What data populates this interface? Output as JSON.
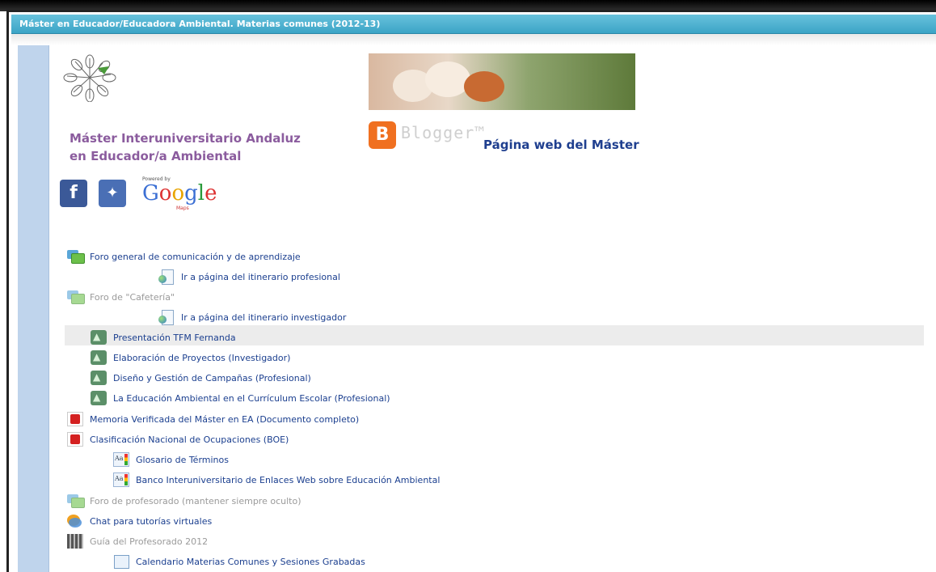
{
  "window": {
    "title": "Máster en Educador/Educadora Ambiental. Materias comunes (2012-13)"
  },
  "header": {
    "program_line1": "Máster Interuniversitario Andaluz",
    "program_line2": "en Educador/a  Ambiental",
    "blogger_label": "Blogger™",
    "web_link": "Página web del Máster",
    "social": {
      "facebook": "f",
      "twitter": "t",
      "google": "Google",
      "powered_by": "Powered by",
      "maps": "Maps"
    }
  },
  "resources": [
    {
      "label": "Foro general de comunicación y de aprendizaje",
      "icon": "forum-icon",
      "hidden": false
    },
    {
      "label": "Ir a página del itinerario profesional",
      "icon": "page-icon",
      "hidden": false
    },
    {
      "label": "Foro de \"Cafetería\"",
      "icon": "forum-icon",
      "hidden": true
    },
    {
      "label": "Ir a página del itinerario investigador",
      "icon": "page-icon",
      "hidden": false
    },
    {
      "label": "Presentación TFM Fernanda",
      "icon": "people-icon",
      "hidden": false
    },
    {
      "label": "Elaboración de Proyectos (Investigador)",
      "icon": "people-icon",
      "hidden": false
    },
    {
      "label": "Diseño y Gestión de Campañas (Profesional)",
      "icon": "people-icon",
      "hidden": false
    },
    {
      "label": "La Educación Ambiental en el Currículum Escolar (Profesional)",
      "icon": "people-icon",
      "hidden": false
    },
    {
      "label": "Memoria Verificada del Máster en EA (Documento completo)",
      "icon": "pdf-icon",
      "hidden": false
    },
    {
      "label": "Clasificación Nacional de Ocupaciones (BOE)",
      "icon": "pdf-icon",
      "hidden": false
    },
    {
      "label": "Glosario de Términos",
      "icon": "glossary-icon",
      "hidden": false
    },
    {
      "label": "Banco Interuniversitario de Enlaces Web sobre Educación Ambiental",
      "icon": "glossary-icon",
      "hidden": false
    },
    {
      "label": "Foro de profesorado (mantener siempre oculto)",
      "icon": "forum-icon",
      "hidden": true
    },
    {
      "label": "Chat para tutorías virtuales",
      "icon": "chat-icon",
      "hidden": false
    },
    {
      "label": "Guía del Profesorado 2012",
      "icon": "guide-icon",
      "hidden": true
    },
    {
      "label": "Calendario Materias Comunes y Sesiones Grabadas",
      "icon": "calendar-icon",
      "hidden": false
    }
  ]
}
